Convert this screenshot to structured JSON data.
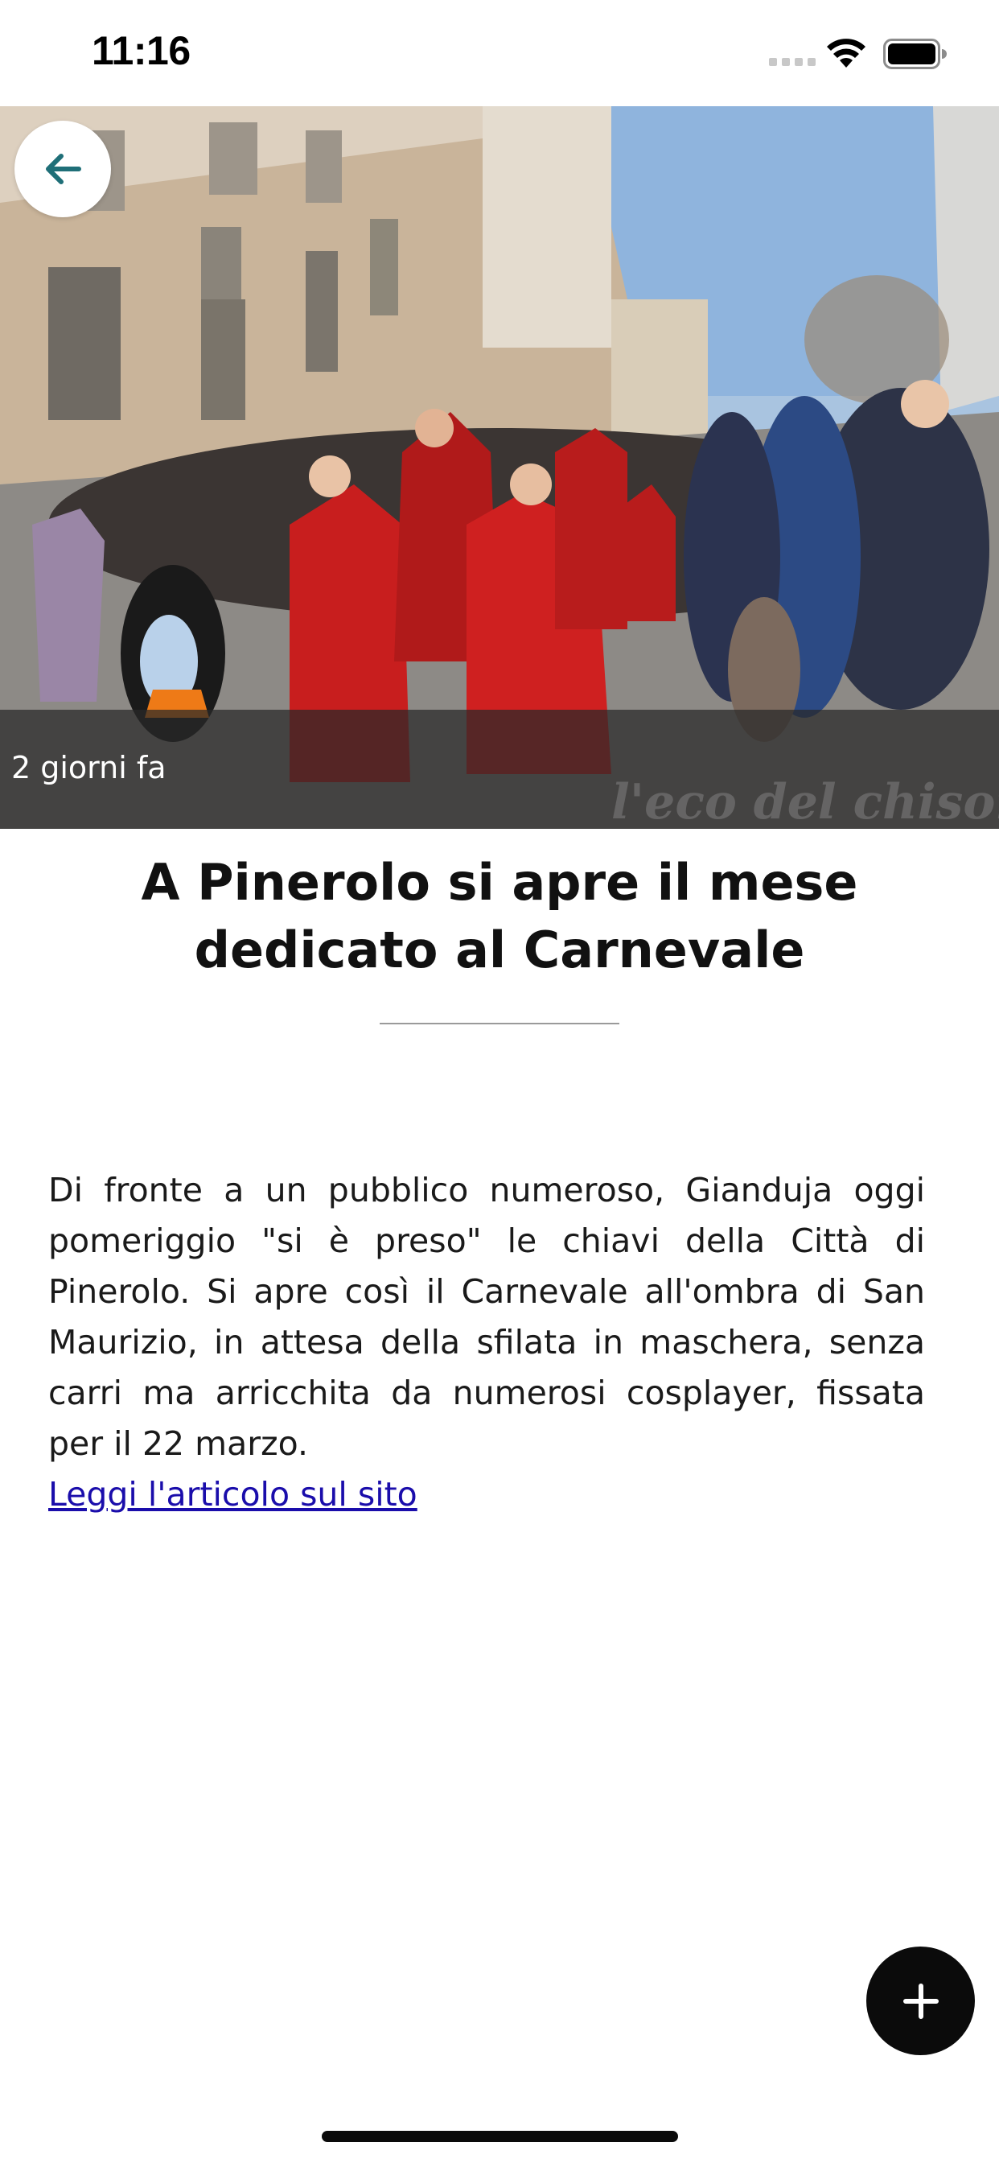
{
  "status_bar": {
    "time": "11:16",
    "icons": [
      "signal-icon",
      "wifi-icon",
      "battery-icon"
    ]
  },
  "hero": {
    "date_label": "2 giorni fa",
    "watermark": "l'eco del chisone.it"
  },
  "article": {
    "title": "A Pinerolo si apre il mese dedicato al Carnevale",
    "body": "Di fronte a un pubblico numeroso, Gianduja oggi pomeriggio \"si è preso\" le chiavi della Città di Pinerolo. Si apre così il Carnevale all'ombra di San Maurizio, in attesa della sfilata in maschera, senza carri ma arricchita da numerosi cosplayer, fissata per il 22 marzo.",
    "link_text": "Leggi l'articolo sul sito"
  },
  "actions": {
    "back_icon": "arrow-left-icon",
    "fab_icon": "plus-icon"
  },
  "colors": {
    "back_arrow": "#1f6f78",
    "link": "#1a0dab",
    "fab_background": "#0b0b0b"
  }
}
